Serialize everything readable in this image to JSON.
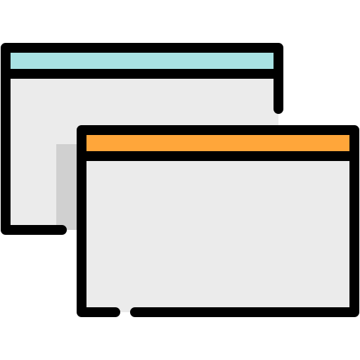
{
  "icon": {
    "name": "multiple-windows-icon",
    "colors": {
      "outline": "#000000",
      "window_body": "#EBEBEB",
      "shadow": "#D0D0D0",
      "back_window_titlebar": "#A8E2E3",
      "front_window_titlebar": "#FFA63A",
      "background": "#FFFFFF"
    }
  }
}
